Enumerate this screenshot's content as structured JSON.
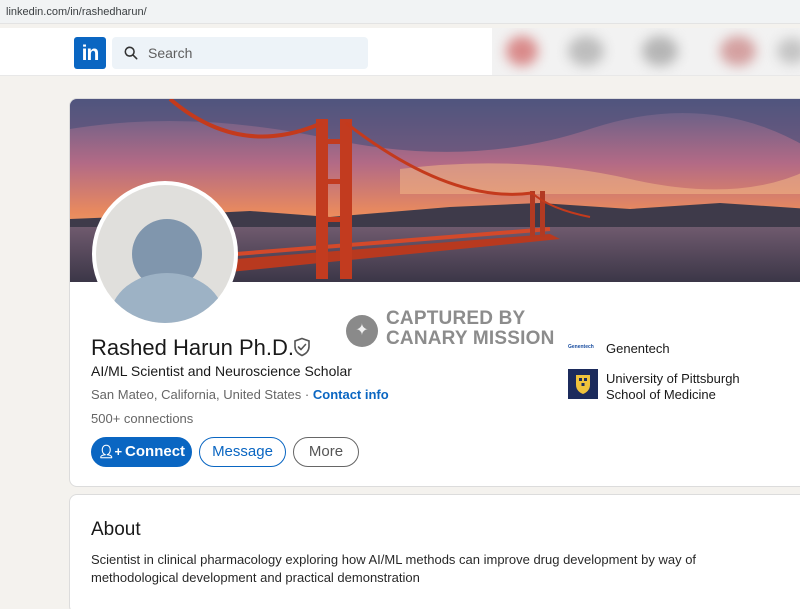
{
  "browser": {
    "url": "linkedin.com/in/rashedharun/"
  },
  "navbar": {
    "logo_text": "in",
    "search_placeholder": "Search"
  },
  "watermark": {
    "line1": "CAPTURED BY",
    "line2": "CANARY MISSION"
  },
  "profile": {
    "name": "Rashed Harun Ph.D.",
    "headline": "AI/ML Scientist and Neuroscience Scholar",
    "location": "San Mateo, California, United States",
    "separator": "·",
    "contact_info_label": "Contact info",
    "connections": "500+ connections"
  },
  "actions": {
    "connect_label": "Connect",
    "message_label": "Message",
    "more_label": "More"
  },
  "companies": [
    {
      "logo_text": "Genentech",
      "name": "Genentech"
    },
    {
      "name_line1": "University of Pittsburgh",
      "name_line2": "School of Medicine"
    }
  ],
  "about": {
    "title": "About",
    "text": "Scientist in clinical pharmacology exploring how AI/ML methods can improve drug development by way of methodological development and practical demonstration"
  },
  "colors": {
    "brand": "#0a66c2",
    "background": "#f4f2ee"
  },
  "icons": [
    "search-icon",
    "verified-shield-icon",
    "add-person-icon",
    "canary-mission-icon"
  ]
}
